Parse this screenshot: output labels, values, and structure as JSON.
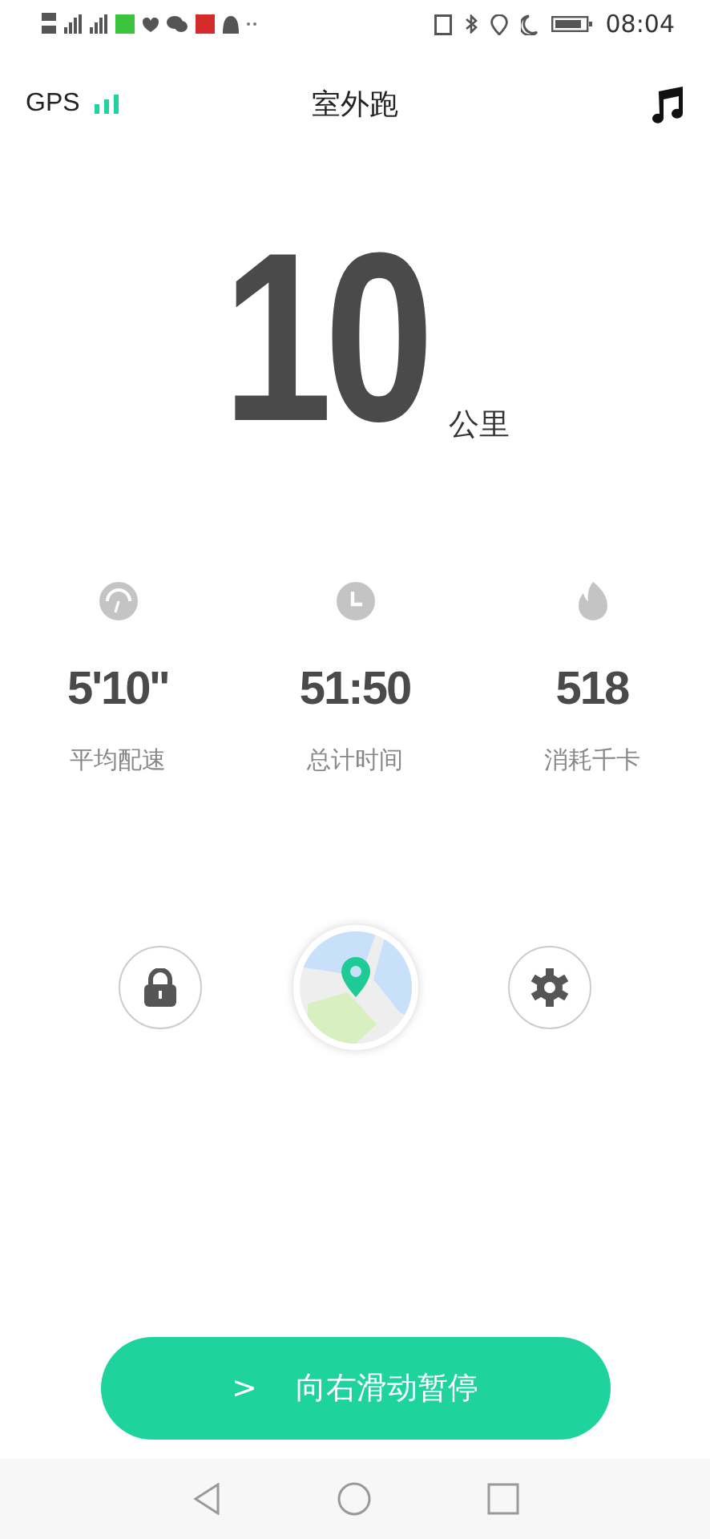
{
  "status_bar": {
    "time": "08:04"
  },
  "header": {
    "gps_label": "GPS",
    "title": "室外跑"
  },
  "distance": {
    "value": "10",
    "unit": "公里"
  },
  "stats": [
    {
      "kind": "pace",
      "value": "5'10''",
      "label": "平均配速"
    },
    {
      "kind": "time",
      "value": "51:50",
      "label": "总计时间"
    },
    {
      "kind": "calories",
      "value": "518",
      "label": "消耗千卡"
    }
  ],
  "slider": {
    "arrow": ">",
    "label": "向右滑动暂停"
  }
}
